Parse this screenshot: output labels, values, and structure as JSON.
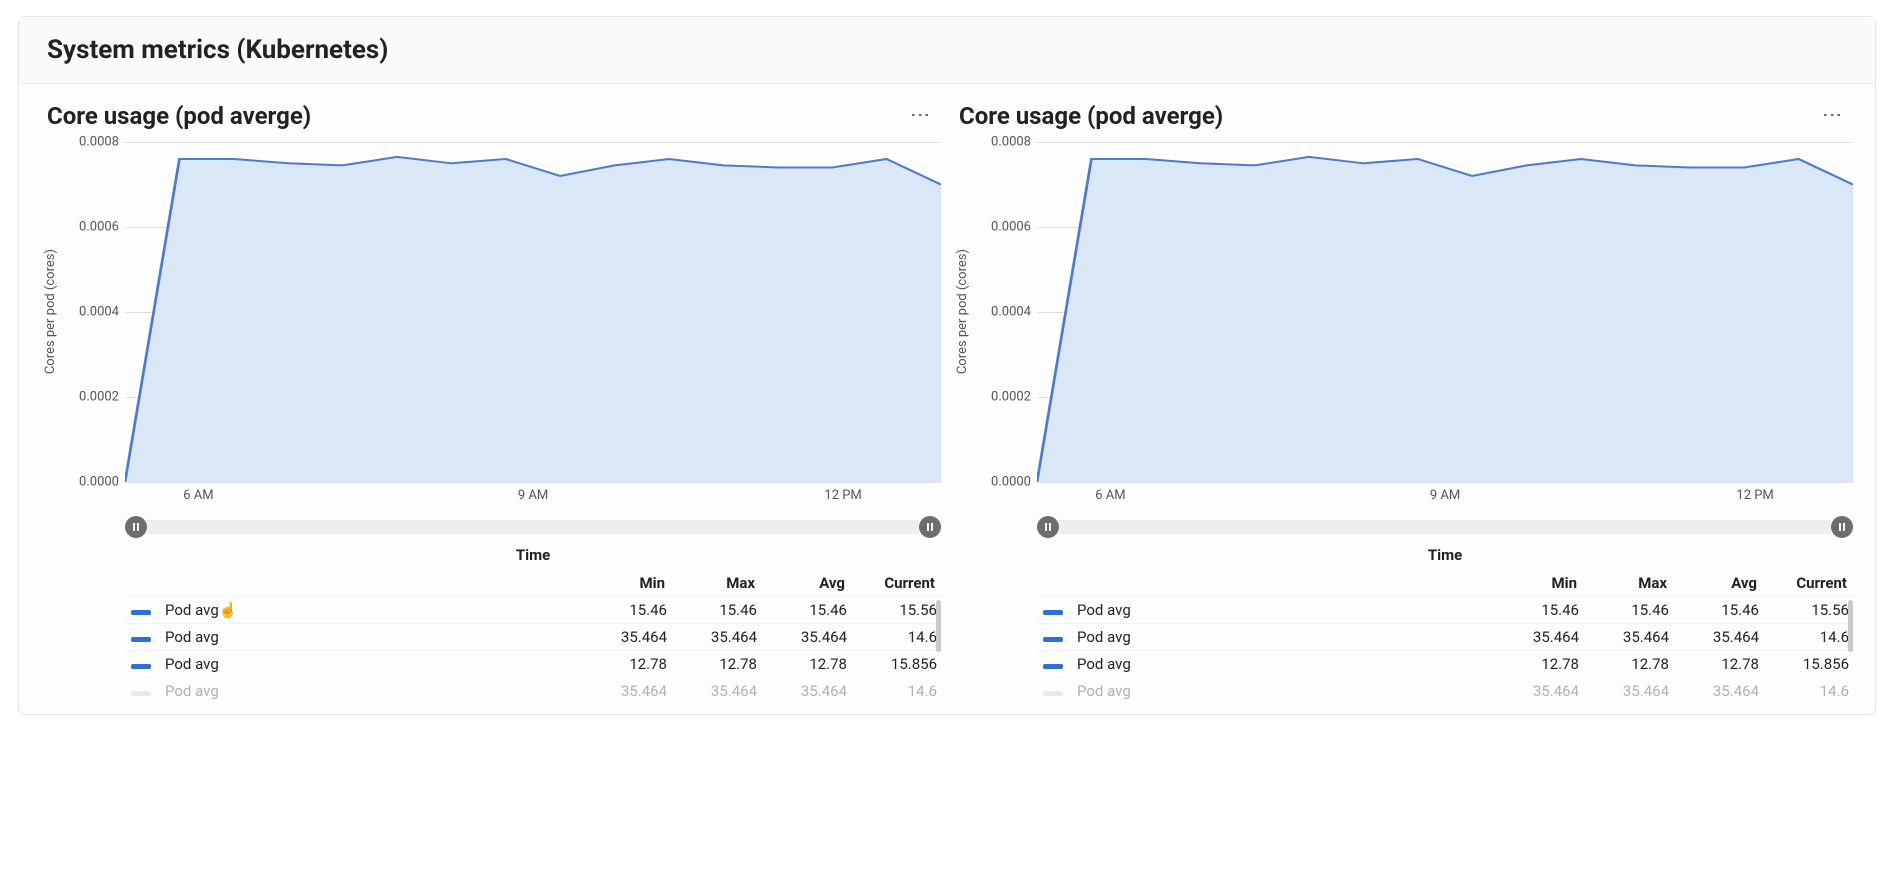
{
  "section_title": "System metrics (Kubernetes)",
  "panel_title": "Core usage (pod averge)",
  "y_axis_label": "Cores per pod (cores)",
  "y_ticks": [
    "0.0008",
    "0.0006",
    "0.0004",
    "0.0002",
    "0.0000"
  ],
  "x_ticks": [
    "6 AM",
    "9 AM",
    "12 PM"
  ],
  "time_label": "Time",
  "stats_headers": [
    "Min",
    "Max",
    "Avg",
    "Current"
  ],
  "legend_label": "Pod avg",
  "legend_color": "#2f6fd0",
  "legend_faded_color": "#b9cbe6",
  "stats_rows": [
    {
      "min": "15.46",
      "max": "15.46",
      "avg": "15.46",
      "current": "15.56",
      "faded": false
    },
    {
      "min": "35.464",
      "max": "35.464",
      "avg": "35.464",
      "current": "14.6",
      "faded": false
    },
    {
      "min": "12.78",
      "max": "12.78",
      "avg": "12.78",
      "current": "15.856",
      "faded": false
    },
    {
      "min": "35.464",
      "max": "35.464",
      "avg": "35.464",
      "current": "14.6",
      "faded": true
    }
  ],
  "cursor_after_first_legend": true,
  "chart_data": {
    "type": "area",
    "title": "Core usage (pod averge)",
    "xlabel": "Time",
    "ylabel": "Cores per pod (cores)",
    "ylim": [
      0,
      0.0008
    ],
    "x": [
      "5:30 AM",
      "6 AM",
      "6:30 AM",
      "7 AM",
      "7:30 AM",
      "8 AM",
      "8:30 AM",
      "9 AM",
      "9:30 AM",
      "10 AM",
      "10:30 AM",
      "11 AM",
      "11:30 AM",
      "12 PM",
      "12:30 PM",
      "1 PM"
    ],
    "series": [
      {
        "name": "Pod avg",
        "values": [
          0.0,
          0.00076,
          0.00076,
          0.00075,
          0.000745,
          0.000765,
          0.00075,
          0.00076,
          0.00072,
          0.000745,
          0.00076,
          0.000745,
          0.00074,
          0.00074,
          0.00076,
          0.0007
        ]
      }
    ],
    "x_tick_labels": [
      "6 AM",
      "9 AM",
      "12 PM"
    ]
  }
}
